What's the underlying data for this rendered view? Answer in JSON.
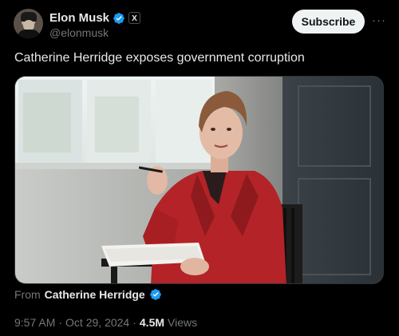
{
  "author": {
    "display_name": "Elon Musk",
    "handle": "@elonmusk",
    "affiliation_badge": "X",
    "verified_color": "#1d9bf0"
  },
  "actions": {
    "subscribe_label": "Subscribe",
    "more_label": "···"
  },
  "post": {
    "text": "Catherine Herridge exposes government corruption",
    "media_icon": "video-thumbnail"
  },
  "source": {
    "from_label": "From",
    "from_name": "Catherine Herridge"
  },
  "meta": {
    "time": "9:57 AM",
    "separator": "·",
    "date": "Oct 29, 2024",
    "separator2": "·",
    "views_count": "4.5M",
    "views_label": "Views"
  }
}
